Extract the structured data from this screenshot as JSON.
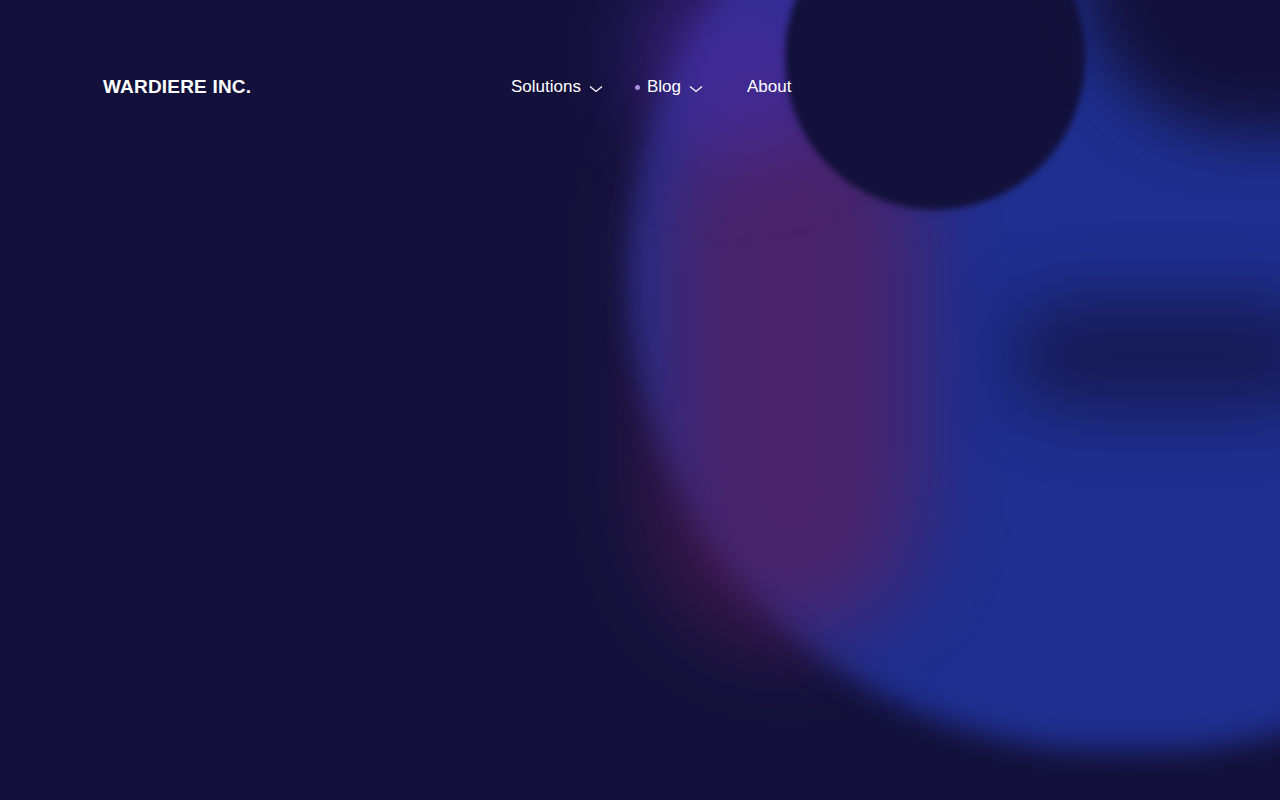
{
  "brand": {
    "name": "WARDIERE INC."
  },
  "nav": [
    {
      "label": "Solutions",
      "dropdown": true,
      "selected": false
    },
    {
      "label": "Blog",
      "dropdown": true,
      "selected": true
    },
    {
      "label": "About",
      "dropdown": false,
      "selected": false
    }
  ]
}
